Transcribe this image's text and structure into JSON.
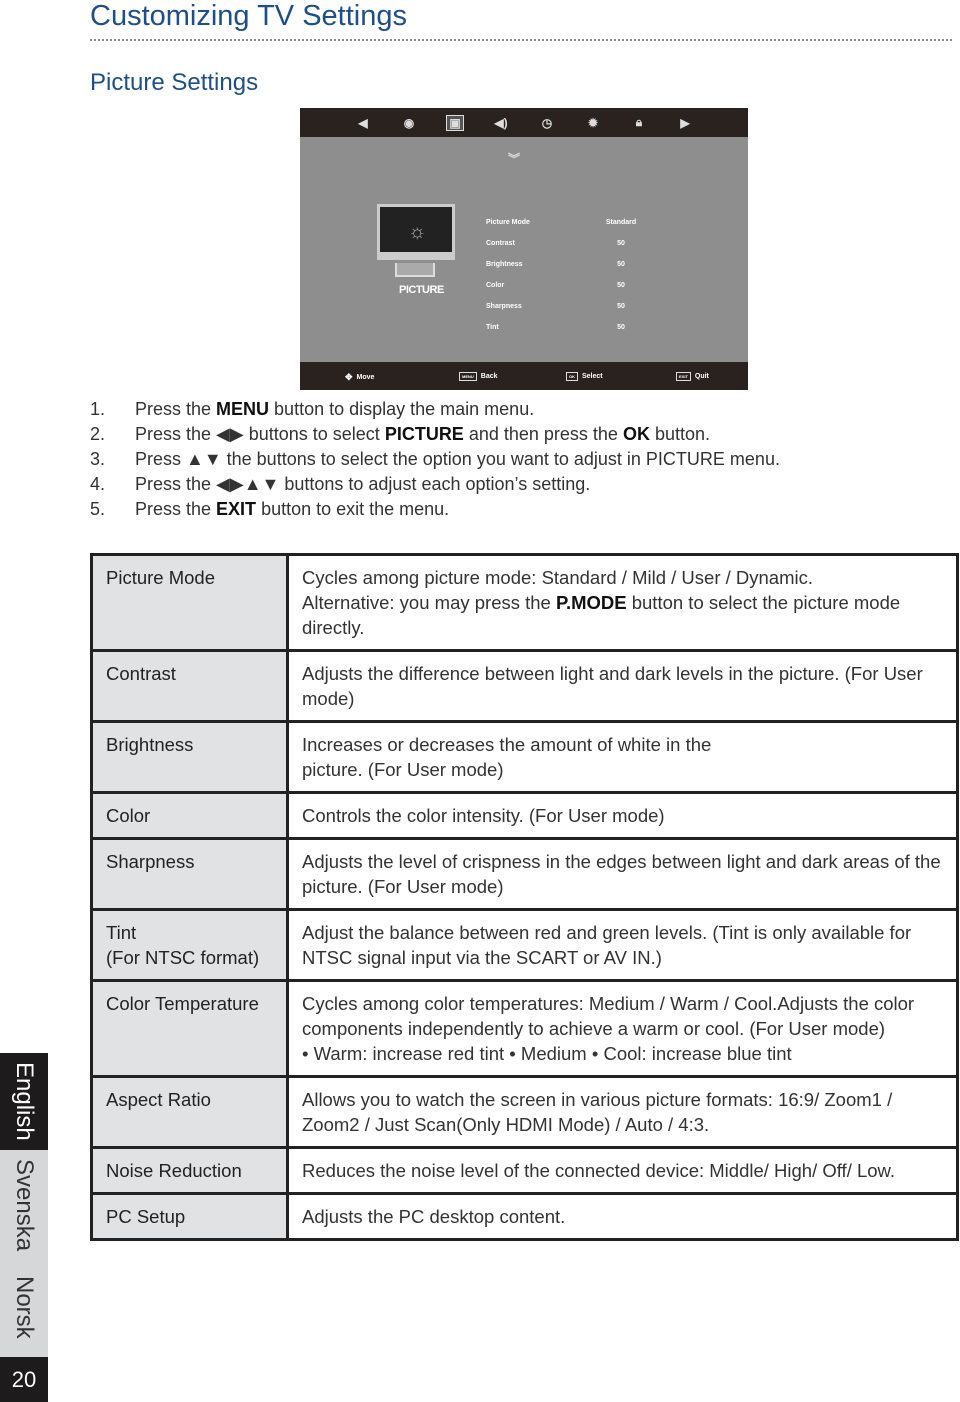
{
  "header": {
    "title": "Customizing TV Settings",
    "section": "Picture Settings"
  },
  "tv_menu": {
    "top_icons": [
      "left-arrow-icon",
      "channel-icon",
      "picture-icon",
      "sound-icon",
      "clock-icon",
      "gear-icon",
      "lock-icon",
      "right-arrow-icon"
    ],
    "category": "PICTURE",
    "items": [
      {
        "label": "Picture Mode",
        "value": "Standard"
      },
      {
        "label": "Contrast",
        "value": "50"
      },
      {
        "label": "Brightness",
        "value": "50"
      },
      {
        "label": "Color",
        "value": "50"
      },
      {
        "label": "Sharpness",
        "value": "50"
      },
      {
        "label": "Tint",
        "value": "50"
      }
    ],
    "footer": [
      {
        "key": "",
        "label": "Move"
      },
      {
        "key": "MENU",
        "label": "Back"
      },
      {
        "key": "OK",
        "label": "Select"
      },
      {
        "key": "EXIT",
        "label": "Quit"
      }
    ]
  },
  "steps": [
    {
      "n": "1.",
      "a": "Press the ",
      "b": "MENU",
      "c": " button to display the main menu."
    },
    {
      "n": "2.",
      "a": "Press the ◀▶  buttons to select ",
      "b": "PICTURE",
      "c": " and then press the ",
      "d": "OK",
      "e": " button."
    },
    {
      "n": "3.",
      "a": "Press ▲▼ the buttons to select the option you want to adjust in PICTURE menu."
    },
    {
      "n": "4.",
      "a": "Press the ◀▶▲▼ buttons to adjust each option’s setting."
    },
    {
      "n": "5.",
      "a": "Press the ",
      "b": "EXIT",
      "c": " button to exit the menu."
    }
  ],
  "table": [
    {
      "k": "Picture Mode",
      "v": "Cycles among picture mode: Standard / Mild / User / Dynamic.",
      "v2a": "Alternative: you may press the ",
      "v2b": "P.MODE",
      "v2c": " button to select the picture mode directly."
    },
    {
      "k": "Contrast",
      "v": "Adjusts the difference between light and dark levels in the picture. (For User mode)"
    },
    {
      "k": "Brightness",
      "v": "Increases or decreases the amount of white in the",
      "v2a": "picture. (For User mode)"
    },
    {
      "k": "Color",
      "v": "Controls the color intensity. (For User mode)"
    },
    {
      "k": "Sharpness",
      "v": "Adjusts the level of crispness in the edges between light and dark areas of the picture. (For User mode)"
    },
    {
      "k": "Tint",
      "k2": "(For NTSC format)",
      "v": "Adjust the balance between red and green levels. (Tint is only available for NTSC signal input via the SCART or AV IN.)"
    },
    {
      "k": "Color Temperature",
      "v": "Cycles among color temperatures: Medium / Warm / Cool.Adjusts the color components independently to achieve a warm or cool. (For User mode)",
      "v2a": "• Warm: increase red tint • Medium • Cool: increase blue tint"
    },
    {
      "k": "Aspect Ratio",
      "v": "Allows you to watch the screen in various picture formats: 16:9/ Zoom1 / Zoom2 / Just Scan(Only HDMI Mode) / Auto / 4:3."
    },
    {
      "k": "Noise Reduction",
      "v": "Reduces the noise level of the connected device: Middle/ High/ Off/ Low."
    },
    {
      "k": "PC Setup",
      "v": "Adjusts the PC desktop content."
    }
  ],
  "side_tabs": {
    "languages": [
      "English",
      "Svenska",
      "Norsk"
    ],
    "page": "20"
  }
}
